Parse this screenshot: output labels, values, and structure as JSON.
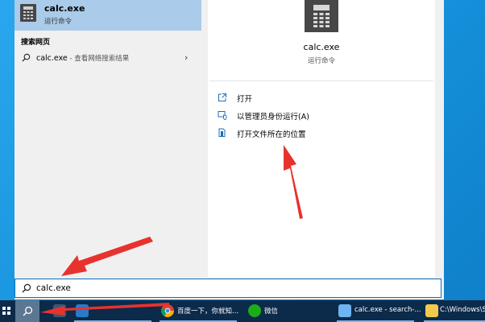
{
  "best_match": {
    "title": "calc.exe",
    "subtitle": "运行命令",
    "icon": "calculator-icon"
  },
  "web_section": {
    "header": "搜索网页",
    "query": "calc.exe",
    "suffix": " - 查看网络搜索结果"
  },
  "details": {
    "title": "calc.exe",
    "subtitle": "运行命令",
    "actions": [
      {
        "label": "打开",
        "icon": "open-icon"
      },
      {
        "label": "以管理员身份运行(A)",
        "icon": "shield-icon"
      },
      {
        "label": "打开文件所在的位置",
        "icon": "file-location-icon"
      }
    ]
  },
  "search": {
    "value": "calc.exe"
  },
  "taskbar": {
    "items": [
      {
        "label": "百度一下，你就知...",
        "icon": "chrome-icon"
      },
      {
        "label": "微信",
        "icon": "wechat-icon"
      },
      {
        "label": "calc.exe - search-...",
        "icon": "app-icon"
      },
      {
        "label": "C:\\Windows\\Sy",
        "icon": "folder-icon"
      }
    ]
  },
  "colors": {
    "selection": "#aacbe9",
    "taskbar": "#0c2a4a",
    "accent": "#0a6fc2",
    "arrow": "#e8322e"
  }
}
